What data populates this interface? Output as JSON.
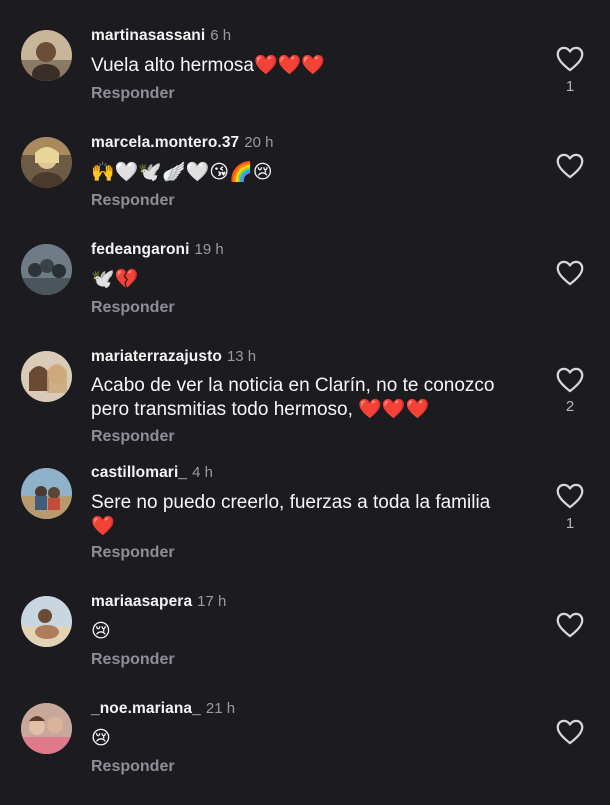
{
  "comments": [
    {
      "username": "martinasassani",
      "time": "6 h",
      "text": "Vuela alto hermosa❤️❤️❤️",
      "reply": "Responder",
      "likes": "1"
    },
    {
      "username": "marcela.montero.37",
      "time": "20 h",
      "text": "🙌🤍🕊️🪽🤍😘🌈😢",
      "reply": "Responder",
      "likes": ""
    },
    {
      "username": "fedeangaroni",
      "time": "19 h",
      "text": "🕊️💔",
      "reply": "Responder",
      "likes": ""
    },
    {
      "username": "mariaterrazajusto",
      "time": "13 h",
      "text": "Acabo de ver la noticia en Clarín, no te conozco\npero transmitias todo hermoso, ❤️❤️❤️",
      "reply": "Responder",
      "likes": "2"
    },
    {
      "username": "castillomari_",
      "time": "4 h",
      "text": "Sere no puedo creerlo, fuerzas a toda la familia\n❤️",
      "reply": "Responder",
      "likes": "1"
    },
    {
      "username": "mariaasapera",
      "time": "17 h",
      "text": "😢",
      "reply": "Responder",
      "likes": ""
    },
    {
      "username": "_noe.mariana_",
      "time": "21 h",
      "text": "😢",
      "reply": "Responder",
      "likes": ""
    }
  ],
  "icons": {
    "like": "heart-outline-icon"
  },
  "colors": {
    "background": "#1b1b20",
    "text": "#f7f7f7",
    "secondary": "#9a9aa2"
  }
}
